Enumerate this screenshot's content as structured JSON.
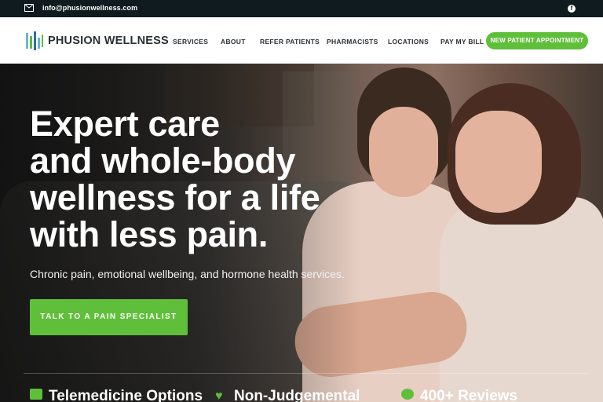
{
  "topbar": {
    "email": "info@phusionwellness.com",
    "mail_icon": "mail-icon",
    "social_icon": "facebook-icon"
  },
  "header": {
    "brand": "PHUSION WELLNESS",
    "nav": [
      "SERVICES",
      "ABOUT",
      "REFER PATIENTS",
      "PHARMACISTS",
      "LOCATIONS",
      "PAY MY BILL"
    ],
    "cta": "NEW PATIENT APPOINTMENT"
  },
  "hero": {
    "headline_lines": [
      "Expert care",
      "and whole-body",
      "wellness for a life",
      "with less pain."
    ],
    "subtitle": "Chronic pain, emotional wellbeing, and hormone health services.",
    "button": "TALK TO A PAIN SPECIALIST"
  },
  "features": [
    {
      "label": "Telemedicine Options",
      "icon": "video-camera-icon"
    },
    {
      "label": "Non-Judgemental",
      "icon": "heart-icon"
    },
    {
      "label": "400+ Reviews",
      "icon": "review-badge-icon"
    }
  ],
  "colors": {
    "accent": "#5fbf3a",
    "topbar": "#0f1b1f",
    "text_dark": "#2b3035"
  }
}
